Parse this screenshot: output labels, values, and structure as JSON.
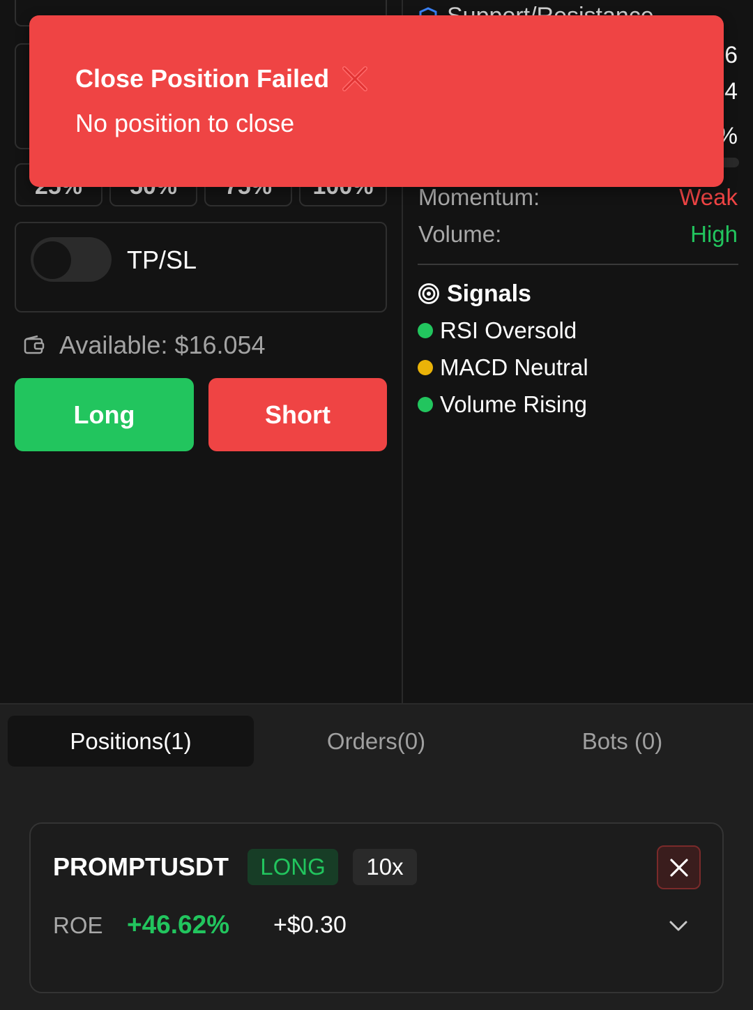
{
  "trade_panel": {
    "pct_buttons": [
      "25%",
      "50%",
      "75%",
      "100%"
    ],
    "tpsl_label": "TP/SL",
    "tpsl_enabled": false,
    "available_label": "Available: $16.054",
    "long_label": "Long",
    "short_label": "Short"
  },
  "analysis_panel": {
    "support_resistance_title": "Support/Resistance",
    "edge_values": [
      "6",
      "4",
      "%"
    ],
    "momentum_label": "Momentum:",
    "momentum_value": "Weak",
    "volume_label": "Volume:",
    "volume_value": "High",
    "signals_title": "Signals",
    "signals": [
      {
        "text": "RSI Oversold",
        "color": "#22c55e"
      },
      {
        "text": "MACD Neutral",
        "color": "#eab308"
      },
      {
        "text": "Volume Rising",
        "color": "#22c55e"
      }
    ]
  },
  "tabs": [
    {
      "label": "Positions(1)",
      "active": true
    },
    {
      "label": "Orders(0)",
      "active": false
    },
    {
      "label": "Bots (0)",
      "active": false
    }
  ],
  "position": {
    "symbol": "PROMPTUSDT",
    "side": "LONG",
    "leverage": "10x",
    "roe_label": "ROE",
    "roe_value": "+46.62%",
    "pnl_value": "+$0.30"
  },
  "toast": {
    "title": "Close Position Failed",
    "message": "No position to close"
  },
  "colors": {
    "green": "#22c55e",
    "red": "#ef4444",
    "background": "#131313"
  }
}
